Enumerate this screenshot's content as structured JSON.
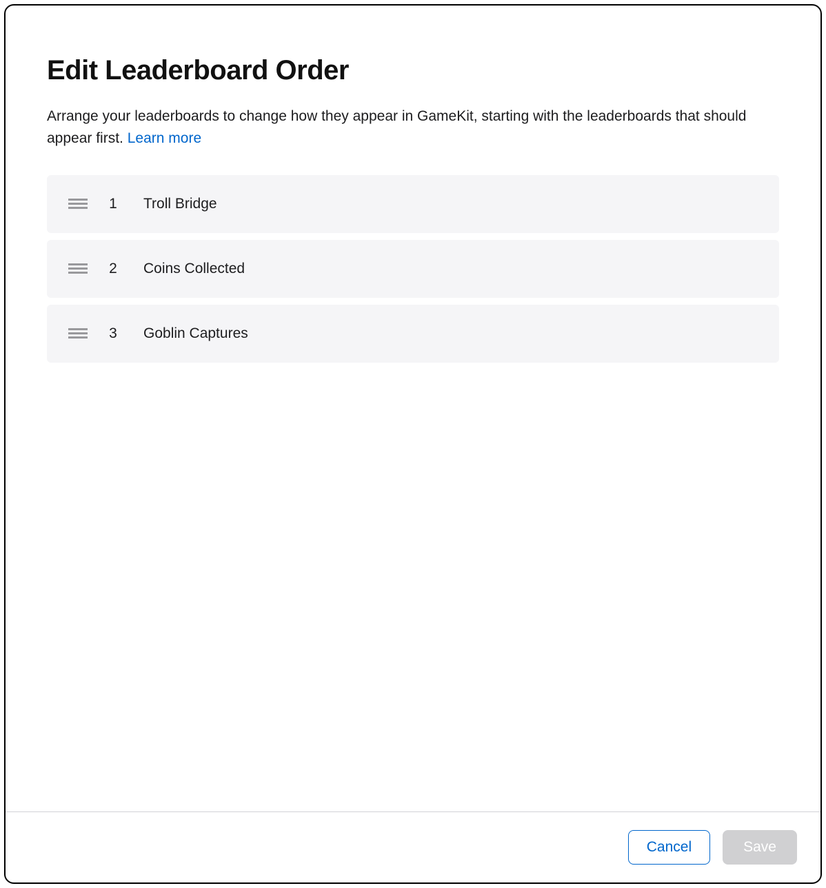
{
  "title": "Edit Leaderboard Order",
  "description_text": "Arrange your leaderboards to change how they appear in GameKit, starting with the leaderboards that should appear first. ",
  "learn_more_label": "Learn more",
  "rows": [
    {
      "index": "1",
      "label": "Troll Bridge"
    },
    {
      "index": "2",
      "label": "Coins Collected"
    },
    {
      "index": "3",
      "label": "Goblin Captures"
    }
  ],
  "footer": {
    "cancel_label": "Cancel",
    "save_label": "Save"
  }
}
